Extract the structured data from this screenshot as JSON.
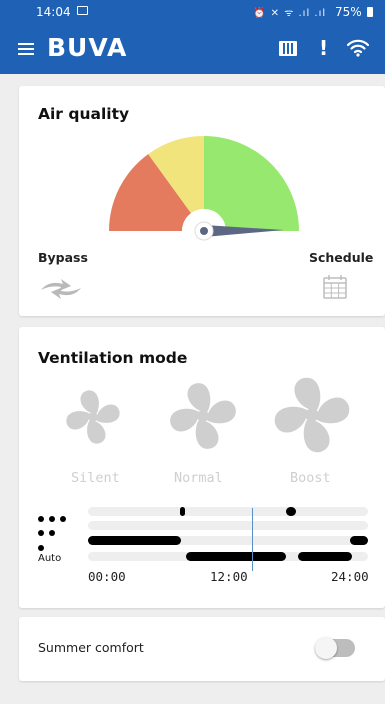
{
  "status_bar": {
    "time": "14:04",
    "right_icons": "⏰ ✕ ᯤ .ıl .ıl",
    "battery": "75%"
  },
  "app_bar": {
    "brand": "BUVA",
    "alert_symbol": "!",
    "icons": [
      "menu-icon",
      "filter-icon",
      "alert-icon",
      "wifi-icon"
    ],
    "color": "#1f62b5"
  },
  "air_quality": {
    "title": "Air quality",
    "gauge_colors": [
      "#e57b5e",
      "#f1e47c",
      "#97e86e"
    ],
    "needle_color": "#5b6783",
    "bypass_label": "Bypass",
    "schedule_label": "Schedule"
  },
  "ventilation": {
    "title": "Ventilation mode",
    "modes": [
      {
        "label": "Silent",
        "icon": "fan-silent-icon"
      },
      {
        "label": "Normal",
        "icon": "fan-normal-icon"
      },
      {
        "label": "Boost",
        "icon": "fan-boost-icon"
      }
    ],
    "auto_label": "Auto",
    "timeline_ticks": [
      "00:00",
      "12:00",
      "24:00"
    ]
  },
  "summer_comfort": {
    "label": "Summer comfort",
    "enabled": false
  }
}
